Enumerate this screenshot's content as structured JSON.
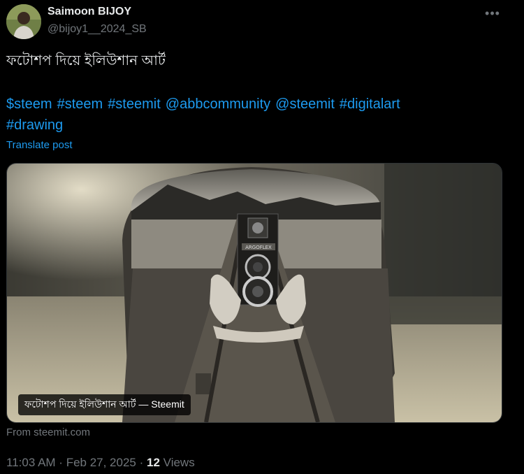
{
  "author": {
    "name": "Saimoon BIJOY",
    "handle": "@bijoy1__2024_SB"
  },
  "post": {
    "text": "ফটোশপ দিয়ে ইলিউশান আর্ট",
    "tags": [
      "$steem",
      "#steem",
      "#steemit",
      "@abbcommunity",
      "@steemit",
      "#digitalart",
      "#drawing"
    ],
    "translate_label": "Translate post"
  },
  "media": {
    "caption": "ফটোশপ দিয়ে ইলিউশান আর্ট — Steemit",
    "camera_brand": "ARGOFLEX"
  },
  "link_source": "From steemit.com",
  "meta": {
    "time": "11:03 AM",
    "separator": " · ",
    "date": "Feb 27, 2025",
    "views_count": "12",
    "views_label": "Views"
  },
  "icons": {
    "more": "more-horizontal-icon"
  }
}
